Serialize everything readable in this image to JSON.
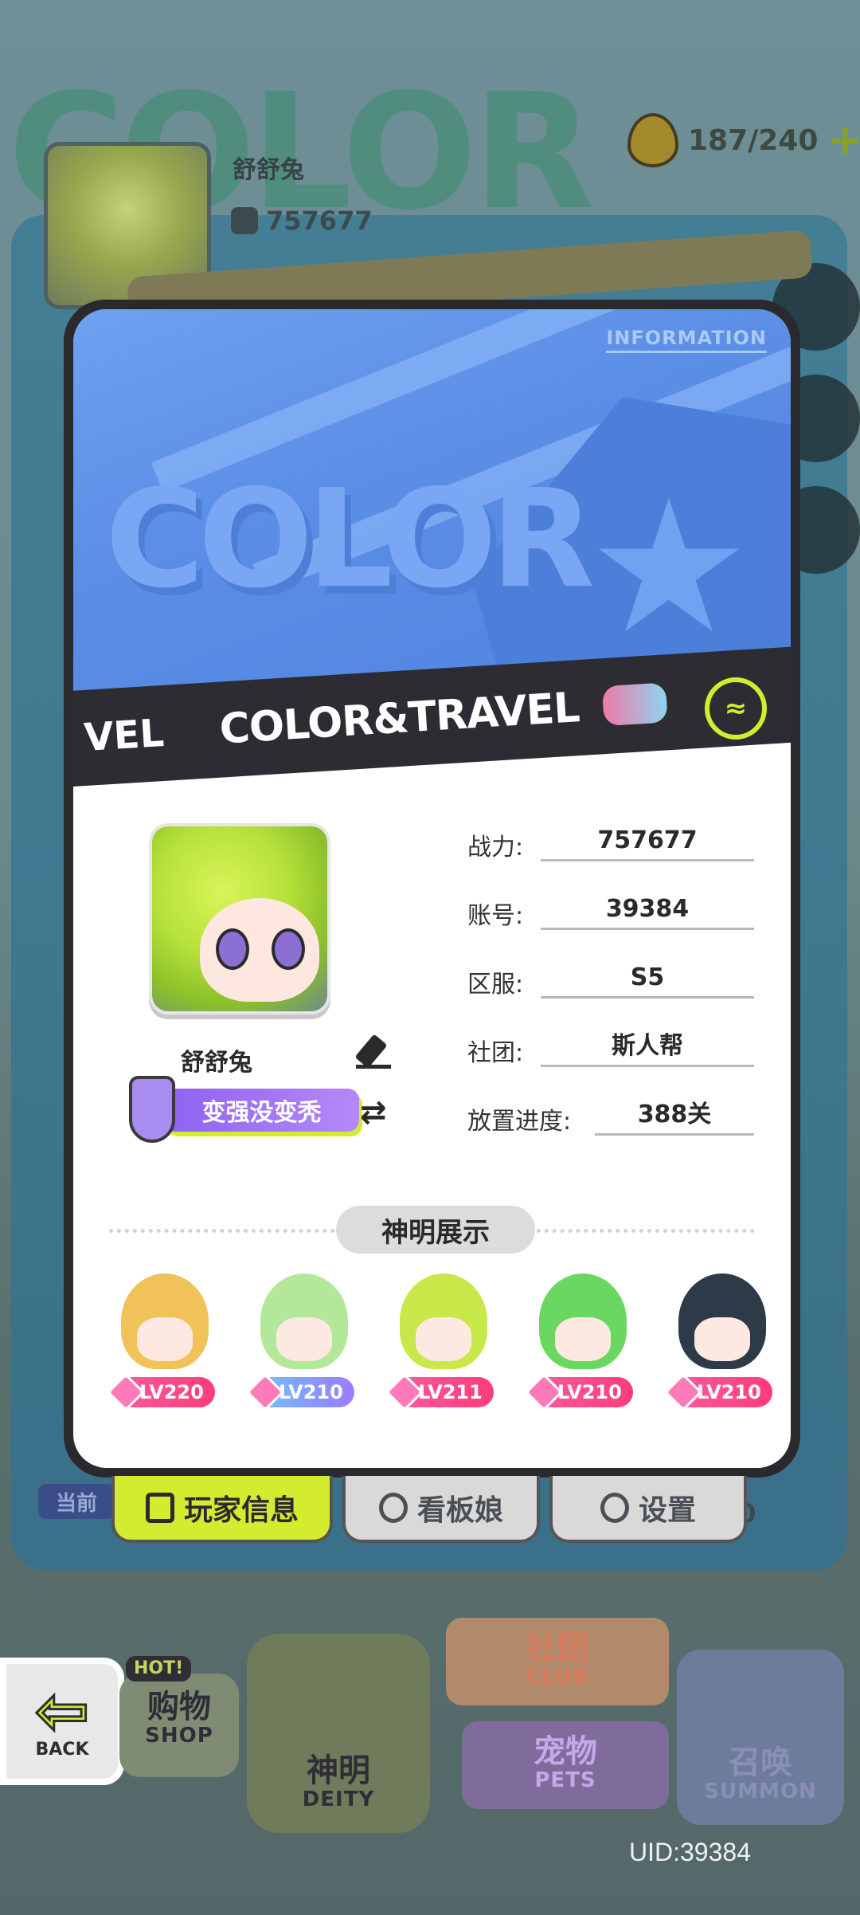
{
  "background": {
    "bg_word": "COLOR",
    "player_name": "舒舒兔",
    "power": "757677",
    "stamina": "187/240",
    "stamina_plus": "+"
  },
  "card": {
    "info_label": "INFORMATION",
    "ribbon_prev": "VEL",
    "ribbon_title": "COLOR&TRAVEL",
    "banner_word": "COLOR",
    "badge": "≈",
    "player_name": "舒舒兔",
    "motto": "变强没变秃",
    "motto_swap": "⇄",
    "stats": [
      {
        "label": "战力:",
        "value": "757677"
      },
      {
        "label": "账号:",
        "value": "39384"
      },
      {
        "label": "区服:",
        "value": "S5"
      },
      {
        "label": "社团:",
        "value": "斯人帮"
      },
      {
        "label": "放置进度:",
        "value": "388关"
      }
    ],
    "deity_section": "神明展示",
    "deities": [
      {
        "level": "LV220",
        "hair": "#f2c25a"
      },
      {
        "level": "LV210",
        "hair": "#b3e89a"
      },
      {
        "level": "LV211",
        "hair": "#c8e84a"
      },
      {
        "level": "LV210",
        "hair": "#6ad860"
      },
      {
        "level": "LV210",
        "hair": "#2d3a48"
      }
    ]
  },
  "tabs": [
    {
      "label": "玩家信息",
      "icon": "id-card-icon",
      "active": true
    },
    {
      "label": "看板娘",
      "icon": "person-icon",
      "active": false
    },
    {
      "label": "设置",
      "icon": "gear-icon",
      "active": false
    }
  ],
  "side_labels": {
    "left": "当前",
    "right": "10"
  },
  "nav": {
    "back": "BACK",
    "shop": "购物",
    "shop_en": "SHOP",
    "shop_hot": "HOT!",
    "deity": "神明",
    "deity_en": "DEITY",
    "club": "社团",
    "club_en": "CLUB",
    "pets": "宠物",
    "pets_en": "PETS",
    "summon": "召唤",
    "summon_en": "SUMMON"
  },
  "uid": "UID:39384",
  "colors": {
    "accent": "#d4ec2f",
    "banner": "#5b8ee6",
    "lv_badge": "#ff3c7a",
    "card_frame": "#2a2a2e"
  }
}
